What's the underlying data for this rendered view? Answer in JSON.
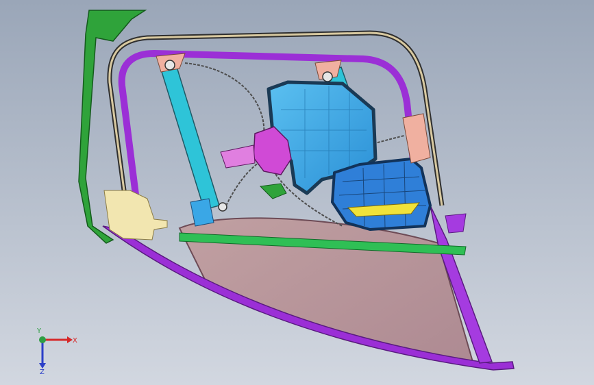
{
  "viewport": {
    "background_top": "#9aa6b8",
    "background_bottom": "#d2d7e0"
  },
  "model": {
    "part_colors": {
      "outer_frame": "#9b2fd6",
      "window_seal": "#3a3a3a",
      "guide_rail": "#2ec4d8",
      "glass": "#b48c8c",
      "belt_line": "#2fbf55",
      "front_bracket": "#2fa33a",
      "regulator_motor": "#d04ad6",
      "door_module_panel": "#3aa7e6",
      "speaker_housing": "#2f7fd8",
      "latch_plate": "#f0e23a",
      "mirror_bracket": "#f2e6b0",
      "clip_parts": "#f0b0a0"
    }
  },
  "triad": {
    "x_label": "X",
    "y_label": "Y",
    "z_label": "Z",
    "x_color": "#d62828",
    "y_color": "#2f9e44",
    "z_color": "#2b3fc8"
  }
}
